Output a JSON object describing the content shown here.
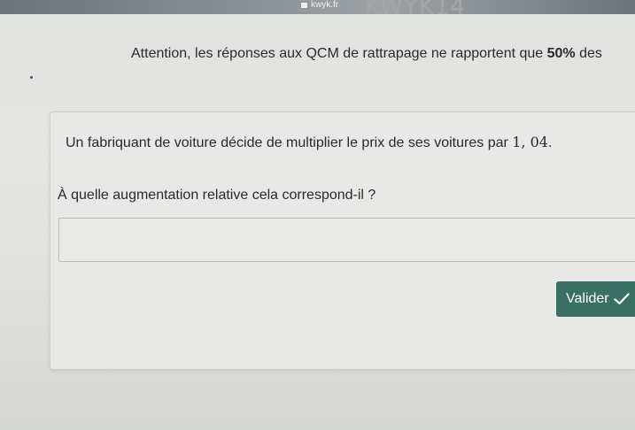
{
  "browser": {
    "url": "kwyk.fr"
  },
  "header": {
    "code": "KWYK14"
  },
  "notice": {
    "text_before": "Attention, les réponses aux QCM de rattrapage ne rapportent que ",
    "percent": "50%",
    "text_after": " des"
  },
  "exercise": {
    "question_text": "Un fabriquant de voiture décide de multiplier le prix de ses voitures par ",
    "multiplier": "1, 04",
    "question_end": ".",
    "prompt": "À quelle augmentation relative cela correspond-il ?",
    "answer_value": "",
    "answer_placeholder": ""
  },
  "actions": {
    "validate_label": "Valider"
  },
  "colors": {
    "button_bg": "#3a6f63",
    "button_text": "#ffffff",
    "card_bg": "#e8e9e6"
  },
  "icons": {
    "validate": "check-icon",
    "url": "site-icon"
  }
}
